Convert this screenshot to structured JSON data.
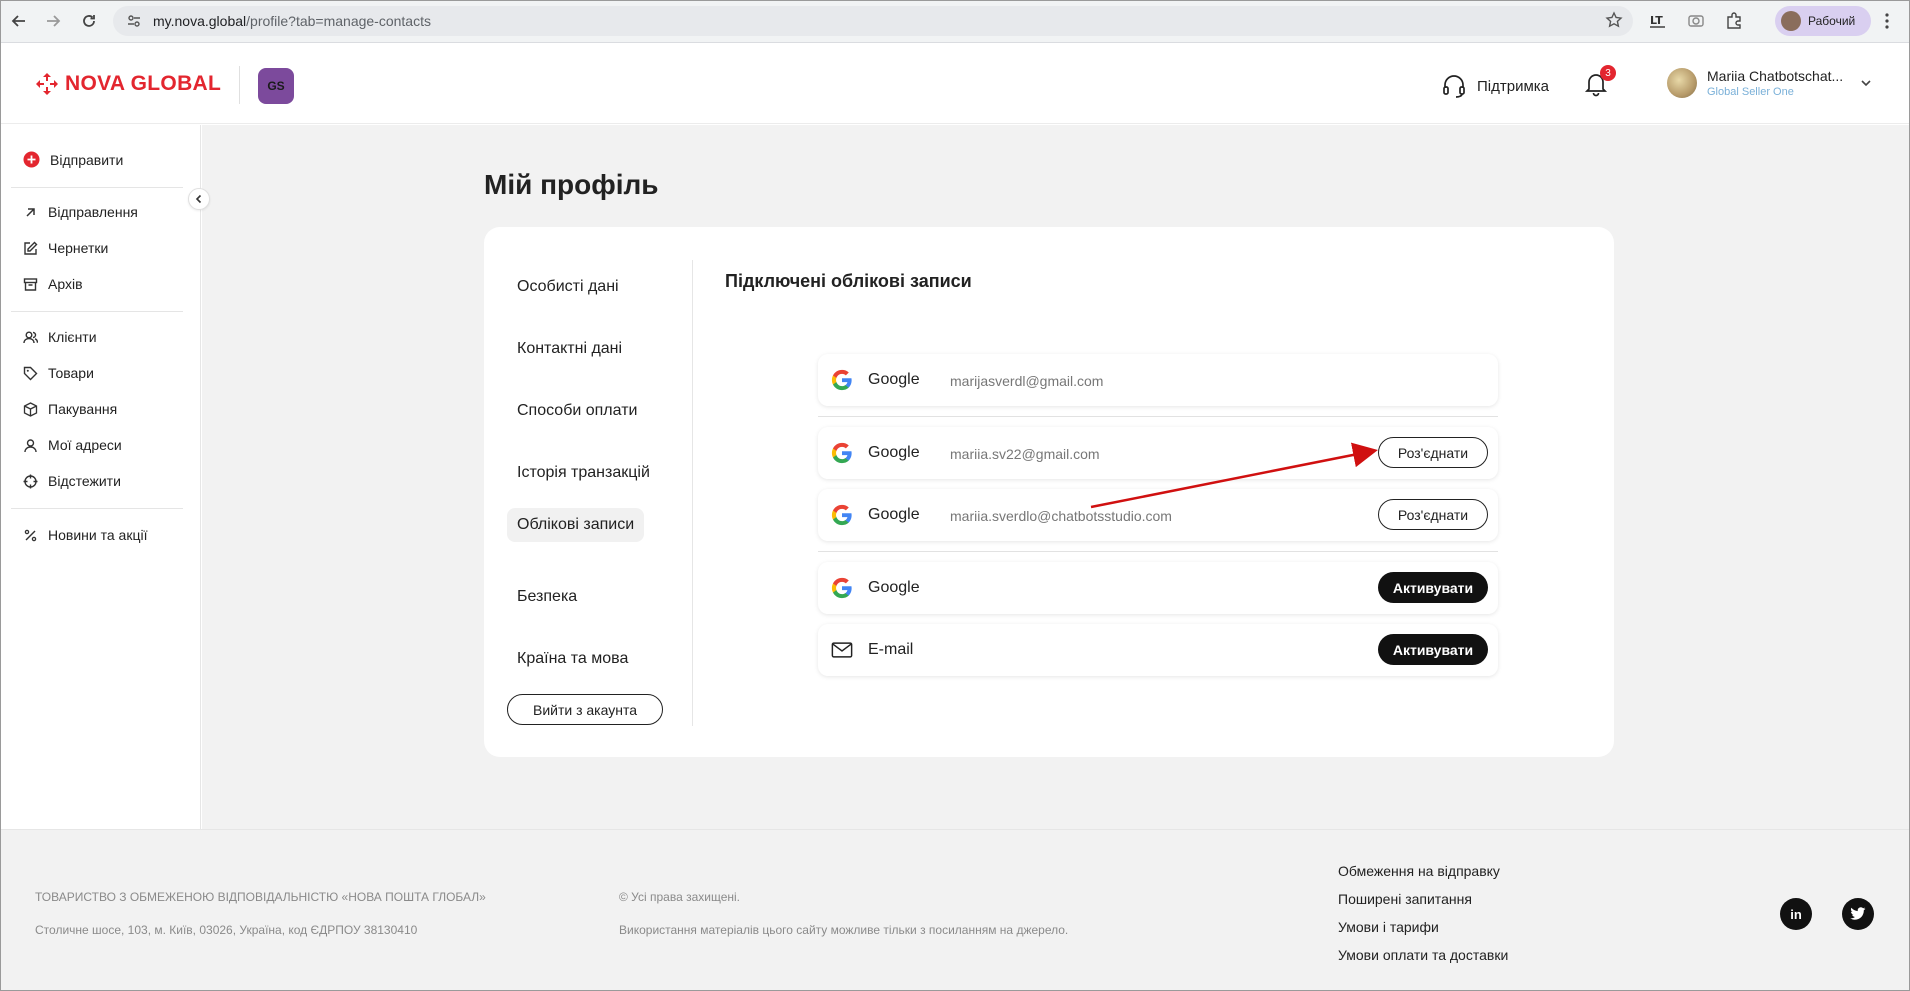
{
  "browser": {
    "url_host": "my.nova.global",
    "url_path": "/profile?tab=manage-contacts",
    "profile_label": "Рабочий"
  },
  "header": {
    "logo_text": "NOVA GLOBAL",
    "badge_text": "GS",
    "support_label": "Підтримка",
    "notifications_count": "3",
    "user_name": "Mariia Chatbotschat...",
    "user_org": "Global Seller One"
  },
  "sidebar": {
    "send_label": "Відправити",
    "groups": [
      [
        "Відправлення",
        "Чернетки",
        "Архів"
      ],
      [
        "Клієнти",
        "Товари",
        "Пакування",
        "Мої адреси",
        "Відстежити"
      ],
      [
        "Новини та акції"
      ]
    ]
  },
  "main": {
    "page_title": "Мій профіль",
    "tabs": [
      "Особисті дані",
      "Контактні дані",
      "Способи оплати",
      "Історія транзакцій",
      "Облікові записи",
      "Безпека",
      "Країна та мова"
    ],
    "active_tab": "Облікові записи",
    "logout_label": "Вийти з акаунта",
    "section_title": "Підключені облікові записи",
    "accounts": [
      {
        "provider": "Google",
        "email": "marijasverdl@gmail.com",
        "action": ""
      },
      {
        "provider": "Google",
        "email": "mariia.sv22@gmail.com",
        "action": "Роз'єднати"
      },
      {
        "provider": "Google",
        "email": "mariia.sverdlo@chatbotsstudio.com",
        "action": "Роз'єднати"
      },
      {
        "provider": "Google",
        "email": "",
        "action": "Активувати"
      },
      {
        "provider": "E-mail",
        "email": "",
        "action": "Активувати"
      }
    ]
  },
  "footer": {
    "company": "ТОВАРИСТВО З ОБМЕЖЕНОЮ ВІДПОВІДАЛЬНІСТЮ «НОВА ПОШТА ГЛОБАЛ»",
    "address": "Столичне шосе, 103, м. Київ, 03026, Україна, код ЄДРПОУ 38130410",
    "rights": "© Усі права захищені.",
    "usage": "Використання матеріалів цього сайту можливе тільки з посиланням на джерело.",
    "links": [
      "Обмеження на відправку",
      "Поширені запитання",
      "Умови і тарифи",
      "Умови оплати та доставки"
    ],
    "social": [
      "in",
      "twitter"
    ]
  },
  "colors": {
    "brand": "#e3262f",
    "badge": "#7c4a9c",
    "annotation": "#d01010"
  }
}
